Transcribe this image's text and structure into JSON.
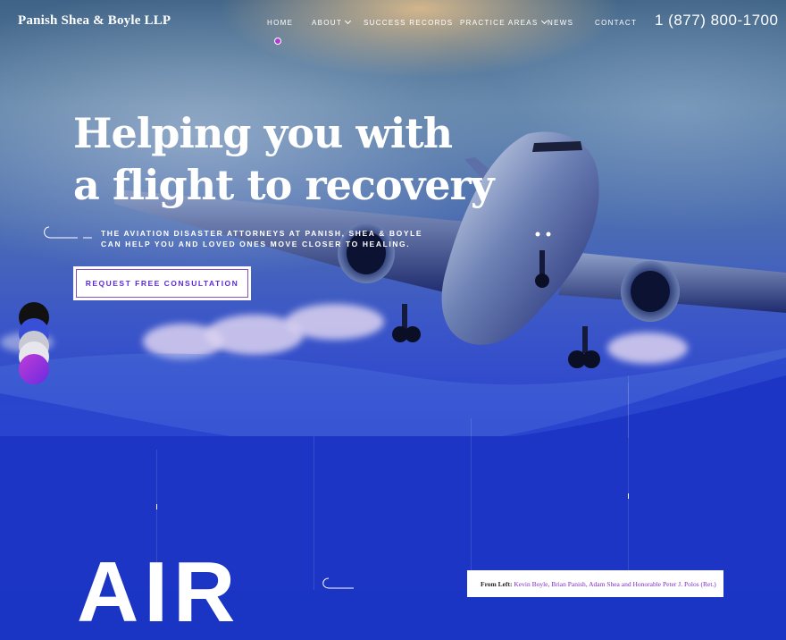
{
  "brand": {
    "name": "Panish Shea & Boyle LLP"
  },
  "nav": {
    "items": [
      {
        "label": "Home",
        "active": true
      },
      {
        "label": "About",
        "has_dropdown": true
      },
      {
        "label": "Success Records"
      },
      {
        "label": "Practice Areas",
        "has_dropdown": true
      },
      {
        "label": "News"
      },
      {
        "label": "Contact"
      }
    ],
    "phone": "1 (877) 800-1700"
  },
  "hero": {
    "headline_line1": "Helping you with",
    "headline_line2": "a flight to recovery",
    "subtext_line1": "The aviation disaster attorneys at Panish, Shea & Boyle",
    "subtext_line2": "can help you and loved ones move closer to healing.",
    "cta_label": "REQUEST FREE CONSULTATION"
  },
  "swatches": [
    "#111111",
    "#3a4fd8",
    "#c9c9d4",
    "#e6e6ec",
    "#9a2bd6"
  ],
  "section": {
    "big_word": "AIR",
    "caption_prefix": "From Left:",
    "caption_names": "Kevin Boyle, Brian Panish, Adam Shea and Honorable Peter J. Polos (Ret.)"
  },
  "colors": {
    "accent": "#5a2bd8",
    "purple": "#9a2bd6",
    "deep_blue": "#1c35c4"
  },
  "icons": {
    "chevron": "chevron-down-icon",
    "airplane": "airplane-image",
    "dot": "active-nav-dot"
  }
}
